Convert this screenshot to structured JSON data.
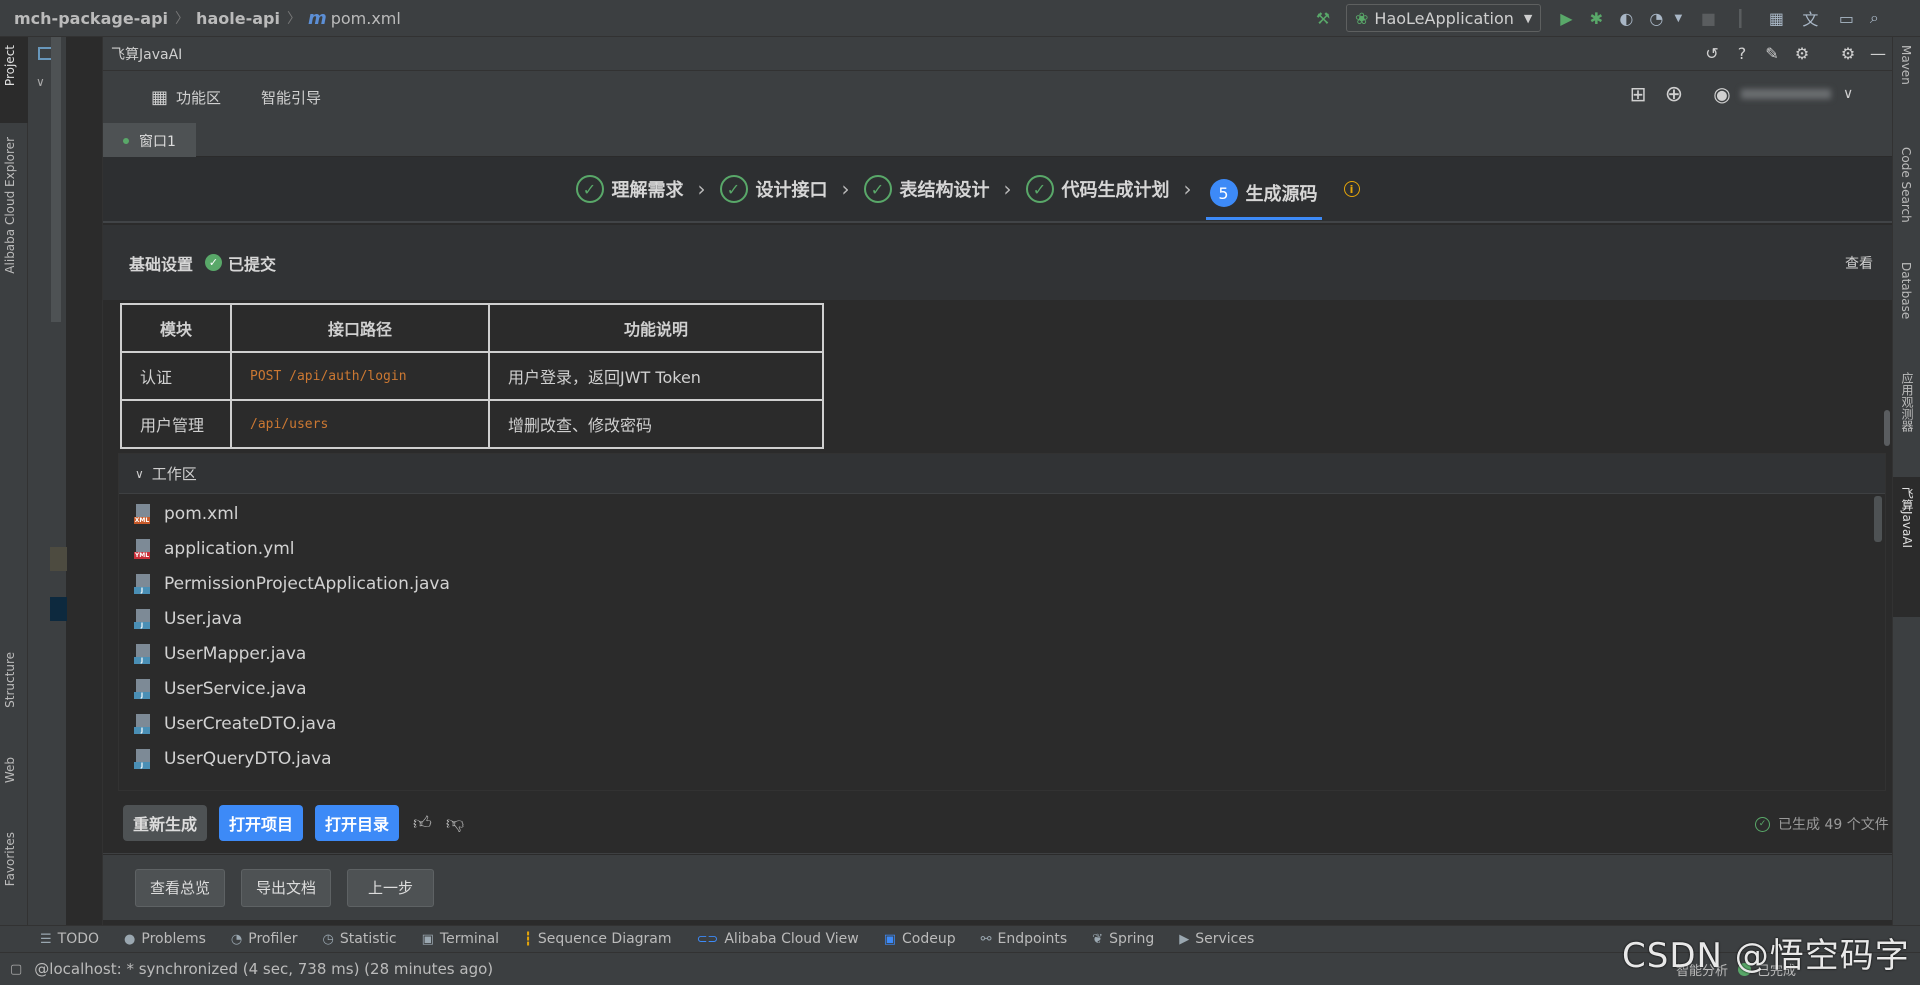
{
  "titlebar": {
    "project": "mch-package-api",
    "module": "haole-api",
    "file_prefix": "m",
    "file": "pom.xml",
    "run_config": "HaoLeApplication"
  },
  "left_stripe": {
    "tabs": [
      "Project",
      "Alibaba Cloud Explorer",
      "Structure",
      "Web",
      "Favorites"
    ]
  },
  "right_stripe": {
    "tabs": [
      "Maven",
      "Code Search",
      "Database",
      "应用观测器",
      "飞算JavaAI"
    ]
  },
  "toolwindow": {
    "title": "飞算JavaAI",
    "nav": {
      "features": "功能区",
      "guide": "智能引导"
    },
    "tab": "窗口1"
  },
  "steps": {
    "items": [
      "理解需求",
      "设计接口",
      "表结构设计",
      "代码生成计划"
    ],
    "current_num": "5",
    "current": "生成源码"
  },
  "basic": {
    "title": "基础设置",
    "status": "已提交",
    "view": "查看"
  },
  "api_table": {
    "headers": [
      "模块",
      "接口路径",
      "功能说明"
    ],
    "rows": [
      [
        "认证",
        "POST /api/auth/login",
        "用户登录，返回JWT Token"
      ],
      [
        "用户管理",
        "/api/users",
        "增删改查、修改密码"
      ]
    ]
  },
  "workarea": {
    "title": "工作区",
    "files": [
      {
        "name": "pom.xml",
        "type": "xml"
      },
      {
        "name": "application.yml",
        "type": "yml"
      },
      {
        "name": "PermissionProjectApplication.java",
        "type": "java"
      },
      {
        "name": "User.java",
        "type": "java"
      },
      {
        "name": "UserMapper.java",
        "type": "java"
      },
      {
        "name": "UserService.java",
        "type": "java"
      },
      {
        "name": "UserCreateDTO.java",
        "type": "java"
      },
      {
        "name": "UserQueryDTO.java",
        "type": "java"
      }
    ]
  },
  "actions": {
    "regenerate": "重新生成",
    "open_project": "打开项目",
    "open_dir": "打开目录",
    "generated": "已生成 49 个文件"
  },
  "bottom_buttons": {
    "overview": "查看总览",
    "export": "导出文档",
    "prev": "上一步"
  },
  "bottom_tools": [
    "TODO",
    "Problems",
    "Profiler",
    "Statistic",
    "Terminal",
    "Sequence Diagram",
    "Alibaba Cloud View",
    "Codeup",
    "Endpoints",
    "Spring",
    "Services"
  ],
  "status": {
    "text": "@localhost: * synchronized (4 sec, 738 ms) (28 minutes ago)",
    "right1": "智能分析",
    "right2": "已完成"
  },
  "watermark": "CSDN @悟空码字",
  "colors": {
    "accent": "#3d8af7",
    "success": "#59a869",
    "code": "#cc7832",
    "bg": "#2b2b2b",
    "panel": "#3c3f41"
  }
}
